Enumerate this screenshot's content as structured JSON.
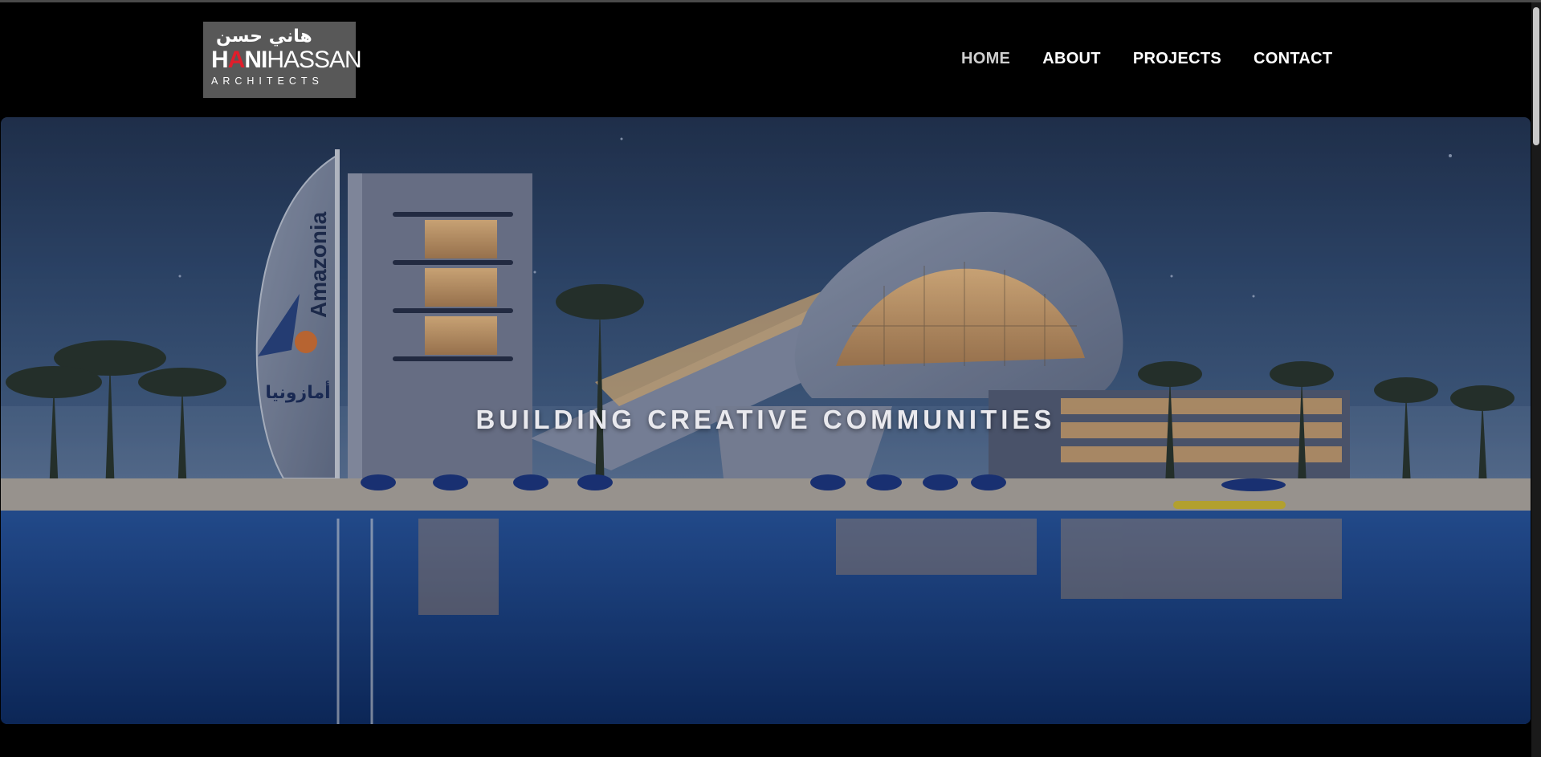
{
  "brand": {
    "arabic_name": "هاني حسن",
    "name_first": "HANI",
    "name_last": "HASSAN",
    "tagline": "ARCHITECTS",
    "accent_color": "#e11d2b"
  },
  "nav": {
    "items": [
      {
        "label": "HOME",
        "active": true
      },
      {
        "label": "ABOUT",
        "active": false
      },
      {
        "label": "PROJECTS",
        "active": false
      },
      {
        "label": "CONTACT",
        "active": false
      }
    ]
  },
  "hero": {
    "title": "BUILDING CREATIVE COMMUNITIES",
    "sign_text": "Amazonia",
    "sign_arabic": "أمازونيا"
  }
}
